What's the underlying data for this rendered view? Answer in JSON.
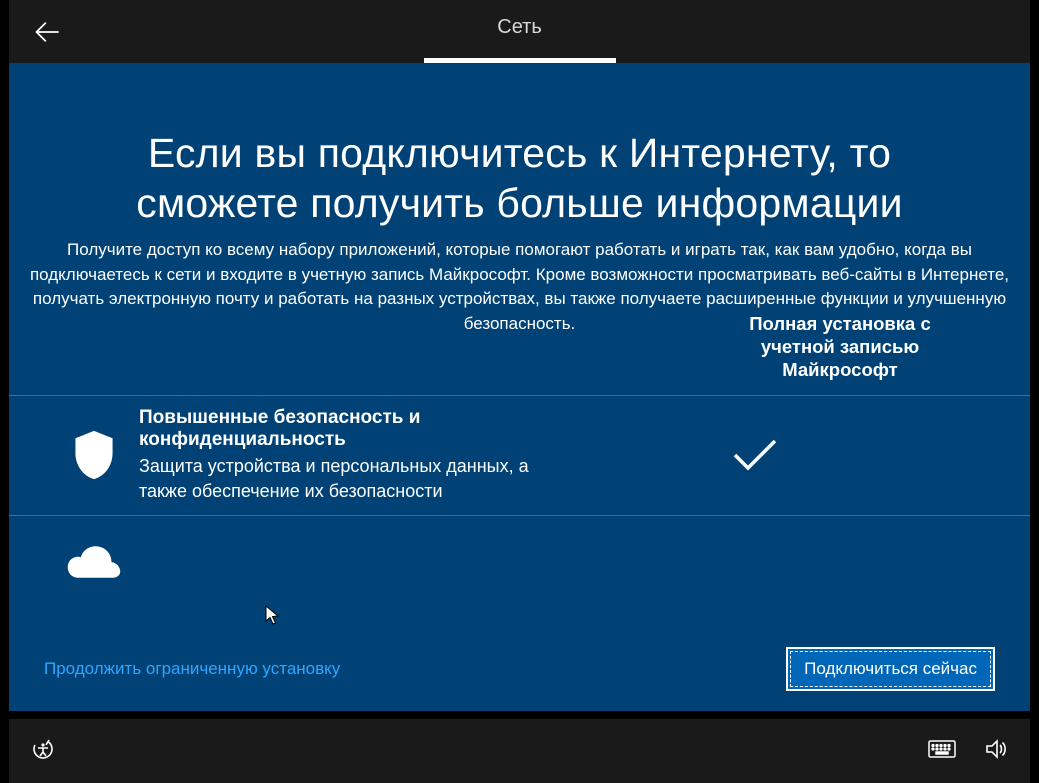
{
  "header": {
    "tab_label": "Сеть"
  },
  "main": {
    "heading": "Если вы подключитесь к Интернету, то сможете получить больше информации",
    "subtext": "Получите доступ ко всему набору приложений, которые помогают работать и играть так, как вам удобно, когда вы подключаетесь к сети и входите в учетную запись Майкрософт. Кроме возможности просматривать веб-сайты в Интернете, получать электронную почту и работать на разных устройствах, вы также получаете расширенные функции и улучшенную безопасность.",
    "column_header": "Полная установка с учетной записью Майкрософт",
    "features": [
      {
        "title": "Повышенные безопасность и конфиденциальность",
        "desc": "Защита устройства и персональных данных, а также обеспечение их безопасности",
        "checked": true
      }
    ]
  },
  "actions": {
    "limited_link": "Продолжить ограниченную установку",
    "connect_button": "Подключиться сейчас"
  }
}
